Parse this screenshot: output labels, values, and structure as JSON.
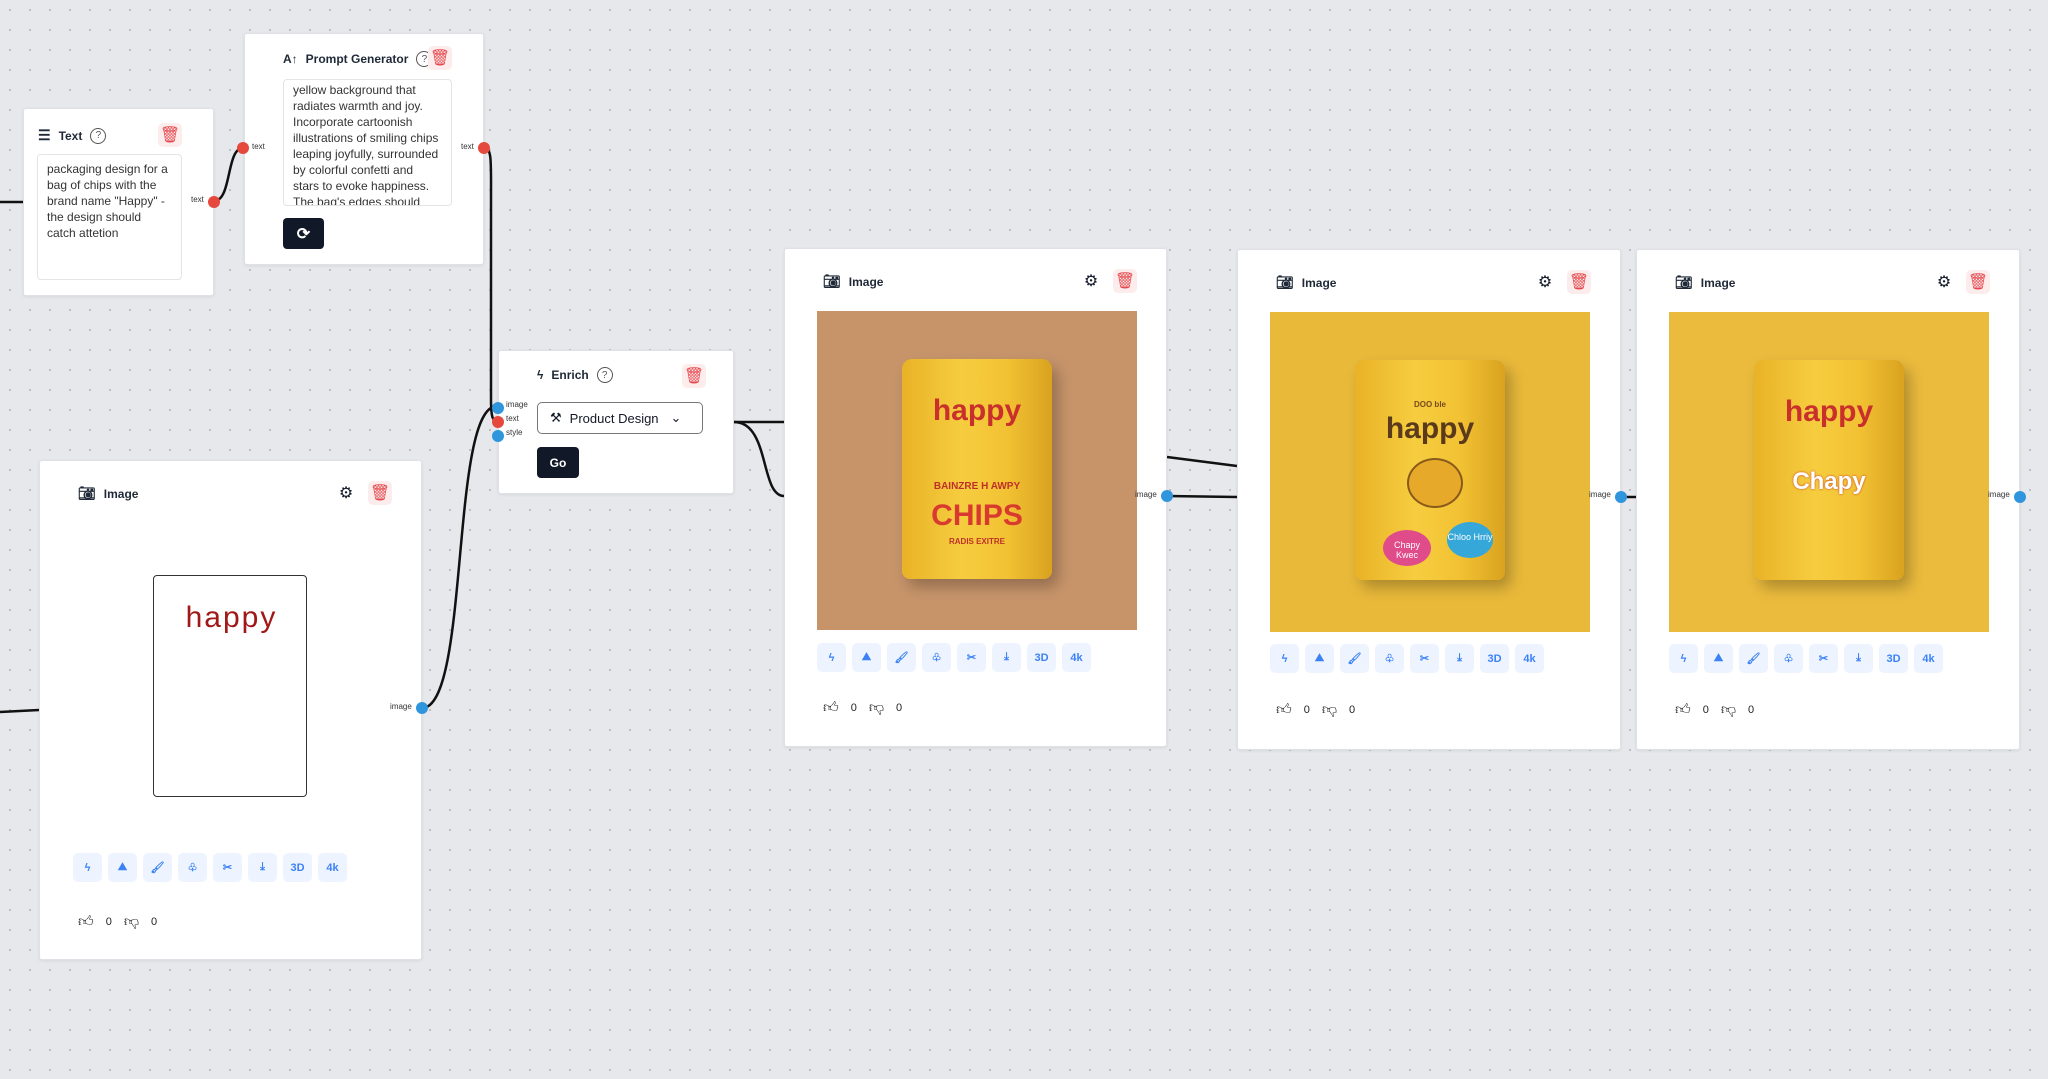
{
  "text_node": {
    "title": "Text",
    "help": "?",
    "value": "packaging design for a bag of chips with the brand name \"Happy\" - the design should catch attetion",
    "port_out": "text"
  },
  "prompt_node": {
    "title": "Prompt Generator",
    "help": "?",
    "value": "yellow background that radiates warmth and joy. Incorporate cartoonish illustrations of smiling chips leaping joyfully, surrounded by colorful confetti and stars to evoke happiness. The bag's edges should",
    "port_in": "text",
    "port_out": "text",
    "regenerate_icon": "refresh-icon"
  },
  "enrich_node": {
    "title": "Enrich",
    "help": "?",
    "ports_in": [
      "image",
      "text",
      "style"
    ],
    "style_select": "Product Design",
    "go_label": "Go"
  },
  "image_nodes": [
    {
      "title": "Image",
      "port": "image",
      "bag_text": "happy",
      "likes": "0",
      "dislikes": "0"
    },
    {
      "title": "Image",
      "port": "image",
      "bag_text": "happy",
      "bag_sub": "BAINZRE H AWPY",
      "bag_big": "CHIPS",
      "bag_small": "RADIS EXITRE",
      "likes": "0",
      "dislikes": "0"
    },
    {
      "title": "Image",
      "port": "image",
      "bag_top": "DOO ble",
      "bag_text": "happy",
      "badge1": "Chapy Kwec",
      "badge2": "Chloo Hrriy",
      "likes": "0",
      "dislikes": "0"
    },
    {
      "title": "Image",
      "port": "image",
      "bag_text": "happy",
      "bag_big": "Chapy",
      "likes": "0",
      "dislikes": "0"
    }
  ],
  "toolbar": {
    "icons": [
      "enrich-icon",
      "scene-icon",
      "brush-icon",
      "variation-icon",
      "cut-icon",
      "download-icon"
    ],
    "label_3d": "3D",
    "label_4k": "4k"
  },
  "colors": {
    "port_text": "#e5483d",
    "port_image": "#2f95dc",
    "bag_yellow": "#f3c332",
    "bag_red": "#d83a2f",
    "tool_blue": "#3b82f6"
  }
}
